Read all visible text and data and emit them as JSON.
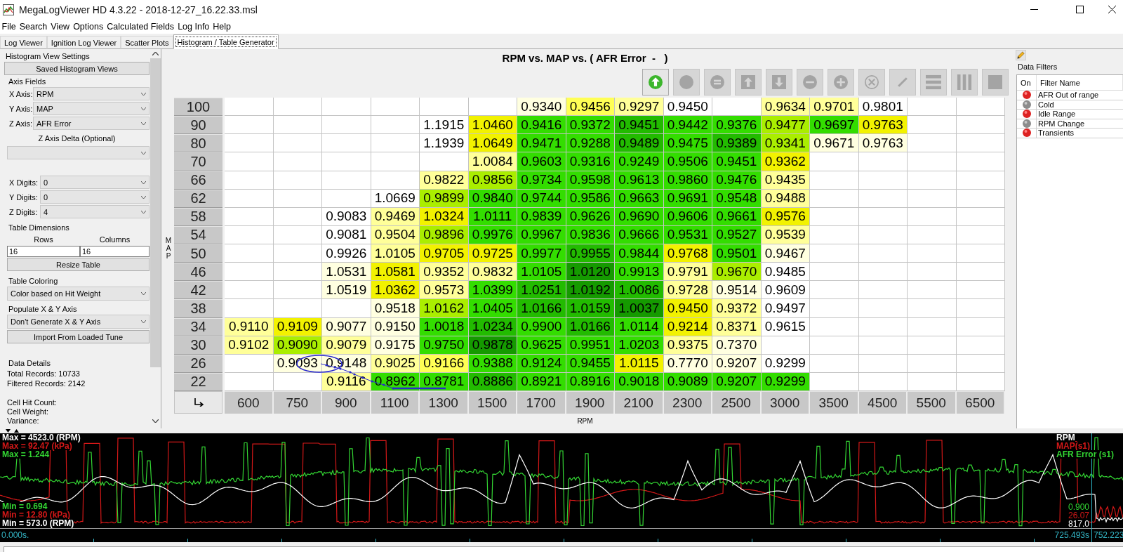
{
  "window": {
    "title": "MegaLogViewer HD 4.3.22 - 2018-12-27_16.22.33.msl"
  },
  "menu": [
    "File",
    "Search",
    "View",
    "Options",
    "Calculated Fields",
    "Log Info",
    "Help"
  ],
  "tabs": [
    {
      "label": "Log Viewer",
      "selected": false
    },
    {
      "label": "Ignition Log Viewer",
      "selected": false
    },
    {
      "label": "Scatter Plots",
      "selected": false
    },
    {
      "label": "Histogram / Table Generator",
      "selected": true
    }
  ],
  "settings": {
    "title": "Histogram View Settings",
    "saved_views_button": "Saved Histogram Views",
    "axis_fields": {
      "title": "Axis Fields",
      "fields": [
        {
          "label": "X Axis:",
          "value": "RPM"
        },
        {
          "label": "Y Axis:",
          "value": "MAP"
        },
        {
          "label": "Z Axis:",
          "value": "AFR Error"
        }
      ],
      "delta_label": "Z Axis Delta (Optional)"
    },
    "digits": [
      {
        "label": "X Digits:",
        "value": "0"
      },
      {
        "label": "Y Digits:",
        "value": "0"
      },
      {
        "label": "Z Digits:",
        "value": "4"
      }
    ],
    "table_dimensions": {
      "title": "Table Dimensions",
      "rows_label": "Rows",
      "columns_label": "Columns",
      "rows": "16",
      "columns": "16",
      "button": "Resize Table"
    },
    "table_coloring": {
      "title": "Table Coloring",
      "value": "Color based on Hit Weight"
    },
    "populate_axis": {
      "title": "Populate X & Y Axis",
      "value": "Don't Generate X & Y Axis",
      "button": "Import From Loaded Tune"
    },
    "data_details": {
      "title": "Data Details",
      "records": [
        "Total Records: 10733",
        "Filtered Records: 2142"
      ],
      "cell_details": [
        "Cell Hit Count:",
        "Cell Weight:",
        "Variance:"
      ]
    }
  },
  "histogram": {
    "title": "RPM vs. MAP vs. ( AFR Error  -   )",
    "toolbar": [
      {
        "kind": "up-circle",
        "disabled": false
      },
      {
        "kind": "circle",
        "disabled": true
      },
      {
        "kind": "equals-circle",
        "disabled": true
      },
      {
        "kind": "up-square",
        "disabled": true
      },
      {
        "kind": "down-square",
        "disabled": true
      },
      {
        "kind": "minus-circle",
        "disabled": true
      },
      {
        "kind": "plus-circle",
        "disabled": true
      },
      {
        "kind": "x-circle",
        "disabled": true
      },
      {
        "kind": "pencil",
        "disabled": true
      },
      {
        "kind": "rows",
        "disabled": true
      },
      {
        "kind": "columns",
        "disabled": true
      },
      {
        "kind": "square",
        "disabled": true
      }
    ],
    "y_label": "MAP",
    "rows": [
      {
        "label": "100",
        "cells": [
          null,
          null,
          null,
          null,
          null,
          null,
          {
            "value": "0.9340",
            "color": "#ffffe0"
          },
          {
            "value": "0.9456",
            "color": "#ffff55"
          },
          {
            "value": "0.9297",
            "color": "#ffff99"
          },
          {
            "value": "0.9450",
            "color": "#ffffff"
          },
          null,
          {
            "value": "0.9634",
            "color": "#ffff99"
          },
          {
            "value": "0.9701",
            "color": "#ffff99"
          },
          {
            "value": "0.9801",
            "color": "#ffffff"
          },
          null,
          null
        ]
      },
      {
        "label": "90",
        "cells": [
          null,
          null,
          null,
          null,
          {
            "value": "1.1915",
            "color": "#ffffff"
          },
          {
            "value": "1.0460",
            "color": "#f2f200"
          },
          {
            "value": "0.9416",
            "color": "#33dd00"
          },
          {
            "value": "0.9372",
            "color": "#33dd00"
          },
          {
            "value": "0.9451",
            "color": "#22bb00"
          },
          {
            "value": "0.9442",
            "color": "#33dd00"
          },
          {
            "value": "0.9376",
            "color": "#33dd00"
          },
          {
            "value": "0.9477",
            "color": "#aaee00"
          },
          {
            "value": "0.9697",
            "color": "#33dd00"
          },
          {
            "value": "0.9763",
            "color": "#f2f200"
          },
          null,
          null
        ]
      },
      {
        "label": "80",
        "cells": [
          null,
          null,
          null,
          null,
          {
            "value": "1.1939",
            "color": "#ffffff"
          },
          {
            "value": "1.0649",
            "color": "#f2f200"
          },
          {
            "value": "0.9471",
            "color": "#33dd00"
          },
          {
            "value": "0.9288",
            "color": "#33dd00"
          },
          {
            "value": "0.9489",
            "color": "#22bb00"
          },
          {
            "value": "0.9475",
            "color": "#33dd00"
          },
          {
            "value": "0.9389",
            "color": "#22bb00"
          },
          {
            "value": "0.9341",
            "color": "#aaee00"
          },
          {
            "value": "0.9671",
            "color": "#ffffe0"
          },
          {
            "value": "0.9763",
            "color": "#ffffe0"
          },
          null,
          null
        ]
      },
      {
        "label": "70",
        "cells": [
          null,
          null,
          null,
          null,
          null,
          {
            "value": "1.0084",
            "color": "#ffff99"
          },
          {
            "value": "0.9603",
            "color": "#33dd00"
          },
          {
            "value": "0.9316",
            "color": "#33dd00"
          },
          {
            "value": "0.9249",
            "color": "#33dd00"
          },
          {
            "value": "0.9506",
            "color": "#33dd00"
          },
          {
            "value": "0.9451",
            "color": "#33dd00"
          },
          {
            "value": "0.9362",
            "color": "#f2f200"
          },
          null,
          null,
          null,
          null
        ]
      },
      {
        "label": "66",
        "cells": [
          null,
          null,
          null,
          null,
          {
            "value": "0.9822",
            "color": "#ffff99"
          },
          {
            "value": "0.9856",
            "color": "#aaee00"
          },
          {
            "value": "0.9734",
            "color": "#33dd00"
          },
          {
            "value": "0.9598",
            "color": "#33dd00"
          },
          {
            "value": "0.9613",
            "color": "#33dd00"
          },
          {
            "value": "0.9860",
            "color": "#33dd00"
          },
          {
            "value": "0.9476",
            "color": "#33dd00"
          },
          {
            "value": "0.9435",
            "color": "#ffff99"
          },
          null,
          null,
          null,
          null
        ]
      },
      {
        "label": "62",
        "cells": [
          null,
          null,
          null,
          {
            "value": "1.0669",
            "color": "#ffffff"
          },
          {
            "value": "0.9899",
            "color": "#aaee00"
          },
          {
            "value": "0.9840",
            "color": "#33dd00"
          },
          {
            "value": "0.9744",
            "color": "#33dd00"
          },
          {
            "value": "0.9586",
            "color": "#33dd00"
          },
          {
            "value": "0.9663",
            "color": "#33dd00"
          },
          {
            "value": "0.9691",
            "color": "#33dd00"
          },
          {
            "value": "0.9548",
            "color": "#33dd00"
          },
          {
            "value": "0.9488",
            "color": "#ffff99"
          },
          null,
          null,
          null,
          null
        ]
      },
      {
        "label": "58",
        "cells": [
          null,
          null,
          {
            "value": "0.9083",
            "color": "#ffffff"
          },
          {
            "value": "0.9469",
            "color": "#ffff99"
          },
          {
            "value": "1.0324",
            "color": "#f2f200"
          },
          {
            "value": "1.0111",
            "color": "#33dd00"
          },
          {
            "value": "0.9839",
            "color": "#33dd00"
          },
          {
            "value": "0.9626",
            "color": "#33dd00"
          },
          {
            "value": "0.9690",
            "color": "#33dd00"
          },
          {
            "value": "0.9606",
            "color": "#33dd00"
          },
          {
            "value": "0.9661",
            "color": "#33dd00"
          },
          {
            "value": "0.9576",
            "color": "#f2f200"
          },
          null,
          null,
          null,
          null
        ]
      },
      {
        "label": "54",
        "cells": [
          null,
          null,
          {
            "value": "0.9081",
            "color": "#ffffff"
          },
          {
            "value": "0.9504",
            "color": "#ffff99"
          },
          {
            "value": "0.9896",
            "color": "#aaee00"
          },
          {
            "value": "0.9976",
            "color": "#33dd00"
          },
          {
            "value": "0.9967",
            "color": "#33dd00"
          },
          {
            "value": "0.9836",
            "color": "#33dd00"
          },
          {
            "value": "0.9666",
            "color": "#33dd00"
          },
          {
            "value": "0.9531",
            "color": "#33dd00"
          },
          {
            "value": "0.9527",
            "color": "#33dd00"
          },
          {
            "value": "0.9539",
            "color": "#ffff99"
          },
          null,
          null,
          null,
          null
        ]
      },
      {
        "label": "50",
        "cells": [
          null,
          null,
          {
            "value": "0.9926",
            "color": "#ffffff"
          },
          {
            "value": "1.0105",
            "color": "#ffff99"
          },
          {
            "value": "0.9705",
            "color": "#f2f200"
          },
          {
            "value": "0.9725",
            "color": "#f2f200"
          },
          {
            "value": "0.9977",
            "color": "#33dd00"
          },
          {
            "value": "0.9955",
            "color": "#22bb00"
          },
          {
            "value": "0.9844",
            "color": "#33dd00"
          },
          {
            "value": "0.9768",
            "color": "#f2f200"
          },
          {
            "value": "0.9501",
            "color": "#33dd00"
          },
          {
            "value": "0.9467",
            "color": "#ffffe0"
          },
          null,
          null,
          null,
          null
        ]
      },
      {
        "label": "46",
        "cells": [
          null,
          null,
          {
            "value": "1.0531",
            "color": "#ffffe0"
          },
          {
            "value": "1.0581",
            "color": "#f2f200"
          },
          {
            "value": "0.9352",
            "color": "#ffff99"
          },
          {
            "value": "0.9832",
            "color": "#ffff99"
          },
          {
            "value": "1.0105",
            "color": "#33dd00"
          },
          {
            "value": "1.0120",
            "color": "#159a00"
          },
          {
            "value": "0.9913",
            "color": "#33dd00"
          },
          {
            "value": "0.9791",
            "color": "#ffff99"
          },
          {
            "value": "0.9670",
            "color": "#aaee00"
          },
          {
            "value": "0.9485",
            "color": "#ffffff"
          },
          null,
          null,
          null,
          null
        ]
      },
      {
        "label": "42",
        "cells": [
          null,
          null,
          {
            "value": "1.0519",
            "color": "#ffffe0"
          },
          {
            "value": "1.0362",
            "color": "#f2f200"
          },
          {
            "value": "0.9573",
            "color": "#ffff99"
          },
          {
            "value": "1.0399",
            "color": "#33dd00"
          },
          {
            "value": "1.0251",
            "color": "#22bb00"
          },
          {
            "value": "1.0192",
            "color": "#159a00"
          },
          {
            "value": "1.0086",
            "color": "#22bb00"
          },
          {
            "value": "0.9728",
            "color": "#ffff99"
          },
          {
            "value": "0.9514",
            "color": "#ffffe0"
          },
          {
            "value": "0.9609",
            "color": "#ffffff"
          },
          null,
          null,
          null,
          null
        ]
      },
      {
        "label": "38",
        "cells": [
          null,
          null,
          null,
          {
            "value": "0.9518",
            "color": "#ffffe0"
          },
          {
            "value": "1.0162",
            "color": "#aaee00"
          },
          {
            "value": "1.0405",
            "color": "#33dd00"
          },
          {
            "value": "1.0166",
            "color": "#22bb00"
          },
          {
            "value": "1.0159",
            "color": "#22bb00"
          },
          {
            "value": "1.0037",
            "color": "#159a00"
          },
          {
            "value": "0.9450",
            "color": "#f2f200"
          },
          {
            "value": "0.9372",
            "color": "#ffff99"
          },
          {
            "value": "0.9497",
            "color": "#ffffff"
          },
          null,
          null,
          null,
          null
        ]
      },
      {
        "label": "34",
        "cells": [
          {
            "value": "0.9110",
            "color": "#ffff99"
          },
          {
            "value": "0.9109",
            "color": "#f2f200"
          },
          {
            "value": "0.9077",
            "color": "#ffffe0"
          },
          {
            "value": "0.9150",
            "color": "#ffffe0"
          },
          {
            "value": "1.0018",
            "color": "#33dd00"
          },
          {
            "value": "1.0234",
            "color": "#22bb00"
          },
          {
            "value": "0.9900",
            "color": "#33dd00"
          },
          {
            "value": "1.0166",
            "color": "#22bb00"
          },
          {
            "value": "1.0114",
            "color": "#33dd00"
          },
          {
            "value": "0.9214",
            "color": "#f2f200"
          },
          {
            "value": "0.8371",
            "color": "#ffff99"
          },
          {
            "value": "0.9615",
            "color": "#ffffff"
          },
          null,
          null,
          null,
          null
        ]
      },
      {
        "label": "30",
        "cells": [
          {
            "value": "0.9102",
            "color": "#ffff99"
          },
          {
            "value": "0.9090",
            "color": "#aaee00"
          },
          {
            "value": "0.9079",
            "color": "#ffff99"
          },
          {
            "value": "0.9175",
            "color": "#ffffe0"
          },
          {
            "value": "0.9750",
            "color": "#33dd00"
          },
          {
            "value": "0.9878",
            "color": "#159a00"
          },
          {
            "value": "0.9625",
            "color": "#33dd00"
          },
          {
            "value": "0.9951",
            "color": "#33dd00"
          },
          {
            "value": "1.0203",
            "color": "#33dd00"
          },
          {
            "value": "0.9375",
            "color": "#ffff99"
          },
          {
            "value": "0.7370",
            "color": "#ffffe0"
          },
          null,
          null,
          null,
          null,
          null
        ]
      },
      {
        "label": "26",
        "cells": [
          null,
          {
            "value": "0.9093",
            "color": "#ffffe0"
          },
          {
            "value": "0.9148",
            "color": "#ffffe0"
          },
          {
            "value": "0.9025",
            "color": "#ffff99"
          },
          {
            "value": "0.9166",
            "color": "#ffff55"
          },
          {
            "value": "0.9388",
            "color": "#33dd00"
          },
          {
            "value": "0.9124",
            "color": "#33dd00"
          },
          {
            "value": "0.9455",
            "color": "#33dd00"
          },
          {
            "value": "1.0115",
            "color": "#f2f200"
          },
          {
            "value": "0.7770",
            "color": "#ffffe0"
          },
          {
            "value": "0.9207",
            "color": "#ffffe0"
          },
          {
            "value": "0.9299",
            "color": "#ffffff"
          },
          null,
          null,
          null,
          null
        ]
      },
      {
        "label": "22",
        "cells": [
          null,
          null,
          {
            "value": "0.9116",
            "color": "#ffff99"
          },
          {
            "value": "0.8962",
            "color": "#33dd00"
          },
          {
            "value": "0.8781",
            "color": "#33dd00"
          },
          {
            "value": "0.8886",
            "color": "#22bb00"
          },
          {
            "value": "0.8921",
            "color": "#33dd00"
          },
          {
            "value": "0.8916",
            "color": "#33dd00"
          },
          {
            "value": "0.9018",
            "color": "#33dd00"
          },
          {
            "value": "0.9089",
            "color": "#33dd00"
          },
          {
            "value": "0.9207",
            "color": "#33dd00"
          },
          {
            "value": "0.9299",
            "color": "#33dd00"
          },
          null,
          null,
          null,
          null
        ]
      }
    ],
    "x_axis": {
      "values": [
        "600",
        "750",
        "900",
        "1100",
        "1300",
        "1500",
        "1700",
        "1900",
        "2100",
        "2300",
        "2500",
        "3000",
        "3500",
        "4500",
        "5500",
        "6500"
      ],
      "label": "RPM"
    }
  },
  "data_filters": {
    "title": "Data Filters",
    "columns": [
      "On",
      "Filter Name"
    ],
    "items": [
      {
        "name": "AFR Out of range",
        "on": true
      },
      {
        "name": "Cold",
        "on": false
      },
      {
        "name": "Idle Range",
        "on": true
      },
      {
        "name": "RPM Change",
        "on": false
      },
      {
        "name": "Transients",
        "on": true
      }
    ]
  },
  "log_chart": {
    "max_labels": [
      {
        "text": "Max = 4523.0 (RPM)",
        "color": "#ffffff"
      },
      {
        "text": "Max = 92.47 (kPa)",
        "color": "#d41818"
      },
      {
        "text": "Max = 1.244",
        "color": "#33d633"
      }
    ],
    "min_labels": [
      {
        "text": "Min = 0.694",
        "color": "#33d633"
      },
      {
        "text": "Min = 12.80 (kPa)",
        "color": "#d41818"
      },
      {
        "text": "Min = 573.0 (RPM)",
        "color": "#ffffff"
      }
    ],
    "legend": [
      {
        "name": "RPM",
        "color": "#ffffff"
      },
      {
        "name": "MAP(s1)",
        "color": "#d41818"
      },
      {
        "name": "AFR Error (s1)",
        "color": "#33d633"
      }
    ],
    "readings": [
      {
        "text": "0.900",
        "color": "#33d633"
      },
      {
        "text": "26.07",
        "color": "#d41818"
      },
      {
        "text": "817.0",
        "color": "#ffffff"
      }
    ],
    "start_time": "0.000s.",
    "cursor_time": "725.493s",
    "end_time": "752.223"
  }
}
